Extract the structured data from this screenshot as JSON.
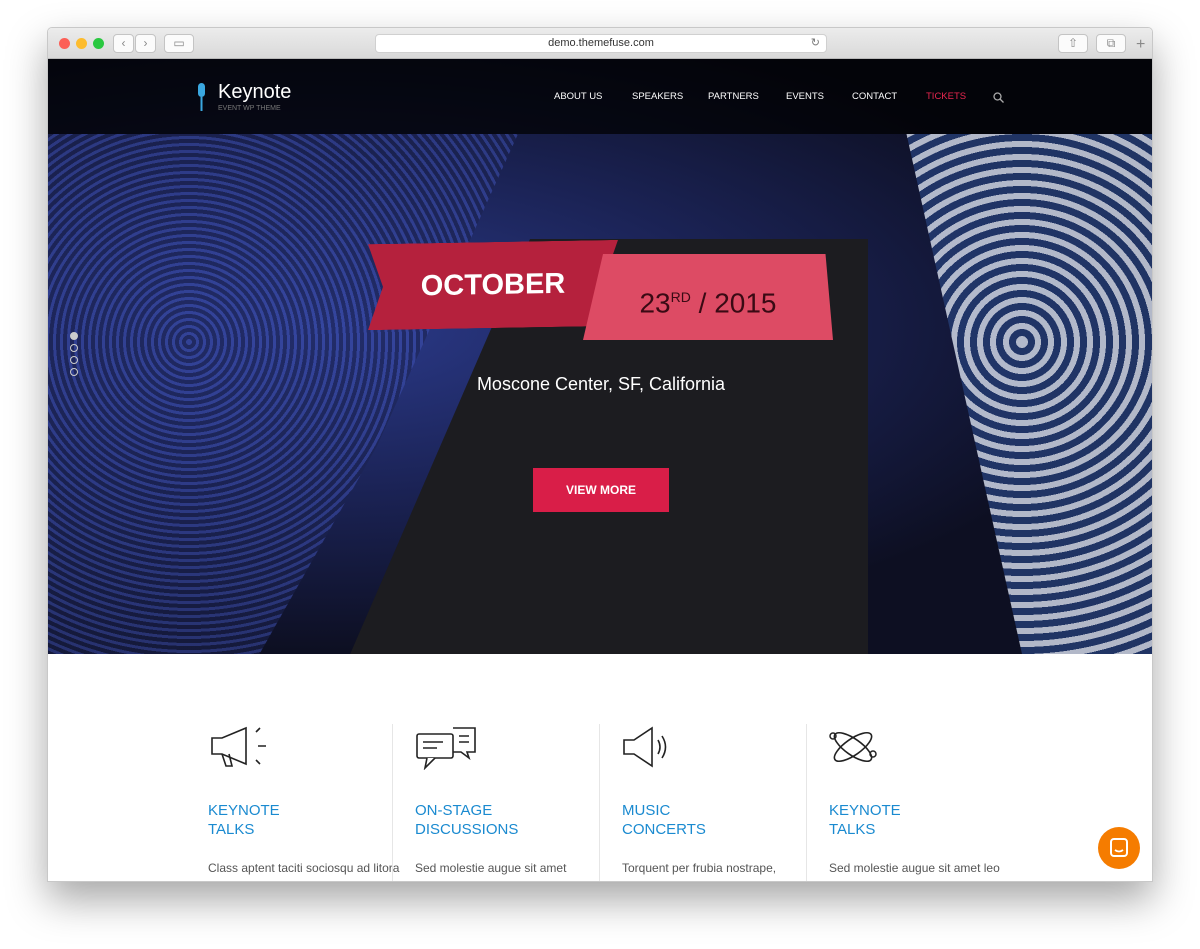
{
  "browser": {
    "url": "demo.themefuse.com"
  },
  "nav": {
    "logo_title": "Keynote",
    "logo_subtitle": "EVENT WP THEME",
    "items": [
      "ABOUT US",
      "SPEAKERS",
      "PARTNERS",
      "EVENTS",
      "CONTACT",
      "TICKETS"
    ],
    "active_color": "#e8264f"
  },
  "hero": {
    "month": "OCTOBER",
    "day": "23",
    "day_suffix": "RD",
    "year": "/ 2015",
    "venue": "Moscone Center, SF, California",
    "cta": "VIEW MORE",
    "slides": 4,
    "active_slide": 1
  },
  "features": [
    {
      "icon": "megaphone-icon",
      "title": "KEYNOTE\nTALKS",
      "text": "Class aptent taciti sociosqu ad litora torquent per frubia nos,"
    },
    {
      "icon": "chat-bubbles-icon",
      "title": "ON-STAGE\nDISCUSSIONS",
      "text": "Sed molestie augue sit amet consequat posue erety. Vesti"
    },
    {
      "icon": "speaker-icon",
      "title": "MUSIC\nCONCERTS",
      "text": "Torquent per frubia nostrape, inceptos hierys nagos. Sedrs"
    },
    {
      "icon": "atom-icon",
      "title": "KEYNOTE\nTALKS",
      "text": "Sed molestie augue sit amet leo consequat posuererety."
    }
  ]
}
